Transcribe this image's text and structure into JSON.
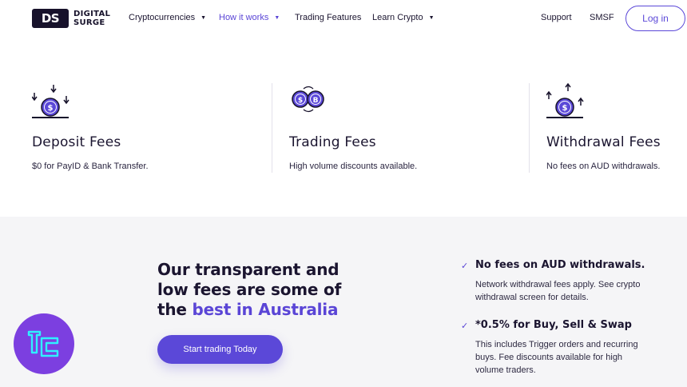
{
  "brand": {
    "mark": "DS",
    "line1": "DIGITAL",
    "line2": "SURGE"
  },
  "nav": {
    "items": [
      {
        "label": "Cryptocurrencies",
        "has_caret": true
      },
      {
        "label": "How it works",
        "has_caret": true,
        "active": true
      },
      {
        "label": "Trading Features",
        "has_caret": false
      },
      {
        "label": "Learn Crypto",
        "has_caret": true
      },
      {
        "label": "Support",
        "has_caret": false
      },
      {
        "label": "SMSF",
        "has_caret": false
      }
    ],
    "login": "Log in"
  },
  "fees": [
    {
      "icon": "deposit-coin-icon",
      "title": "Deposit Fees",
      "desc": "$0 for PayID & Bank Transfer."
    },
    {
      "icon": "trading-coins-icon",
      "title": "Trading Fees",
      "desc": "High volume discounts available."
    },
    {
      "icon": "withdrawal-coin-icon",
      "title": "Withdrawal Fees",
      "desc": "No fees on AUD withdrawals."
    }
  ],
  "promo": {
    "headline_line1": "Our transparent and",
    "headline_line2": "low fees are some of",
    "headline_line3_prefix": "the ",
    "headline_highlight": "best in Australia",
    "cta": "Start trading Today"
  },
  "features": [
    {
      "title": "No fees on AUD withdrawals.",
      "desc": "Network withdrawal fees apply. See crypto withdrawal screen for details."
    },
    {
      "title": "*0.5% for Buy, Sell & Swap",
      "desc": "This includes Trigger orders and recurring buys. Fee discounts available for high volume traders."
    }
  ],
  "colors": {
    "accent": "#5b48d8",
    "dark": "#17122b",
    "section_bg": "#f5f5f7",
    "badge": "#7c3fe0"
  },
  "badge_icon": "tradingfinder-logo-icon"
}
